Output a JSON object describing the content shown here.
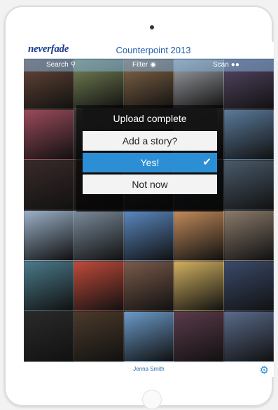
{
  "app": {
    "logo_text": "neverfade",
    "event_title": "Counterpoint 2013"
  },
  "toolbar": {
    "search_label": "Search",
    "search_icon": "search-icon",
    "filter_label": "Filter",
    "filter_icon": "eye-icon",
    "scan_label": "Scan",
    "scan_icon": "glasses-icon"
  },
  "modal": {
    "title": "Upload complete",
    "question": "Add a story?",
    "yes_label": "Yes!",
    "no_label": "Not now",
    "accent_color": "#2c8fd6"
  },
  "footer": {
    "user_name": "Jenna Smith",
    "settings_icon": "gear-icon"
  },
  "photos": [
    "#6b4a3a",
    "#7c8a5a",
    "#8a6b4a",
    "#a6a8ae",
    "#5a4a6a",
    "#9a4a5a",
    "#3a3a3a",
    "#2a2a2a",
    "#4a4a4a",
    "#5a7a9a",
    "#3a2a2a",
    "#2a2020",
    "#302828",
    "#202830",
    "#4a5a6a",
    "#9ab0c8",
    "#7a8a9a",
    "#5a88c0",
    "#c08a5a",
    "#8a7a6a",
    "#4a7a8a",
    "#c04a3a",
    "#7a5a4a",
    "#d0b060",
    "#3a4a6a",
    "#2a2a2a",
    "#4a3a2a",
    "#6a9ac8",
    "#5a3a4a",
    "#5a6a8a"
  ]
}
